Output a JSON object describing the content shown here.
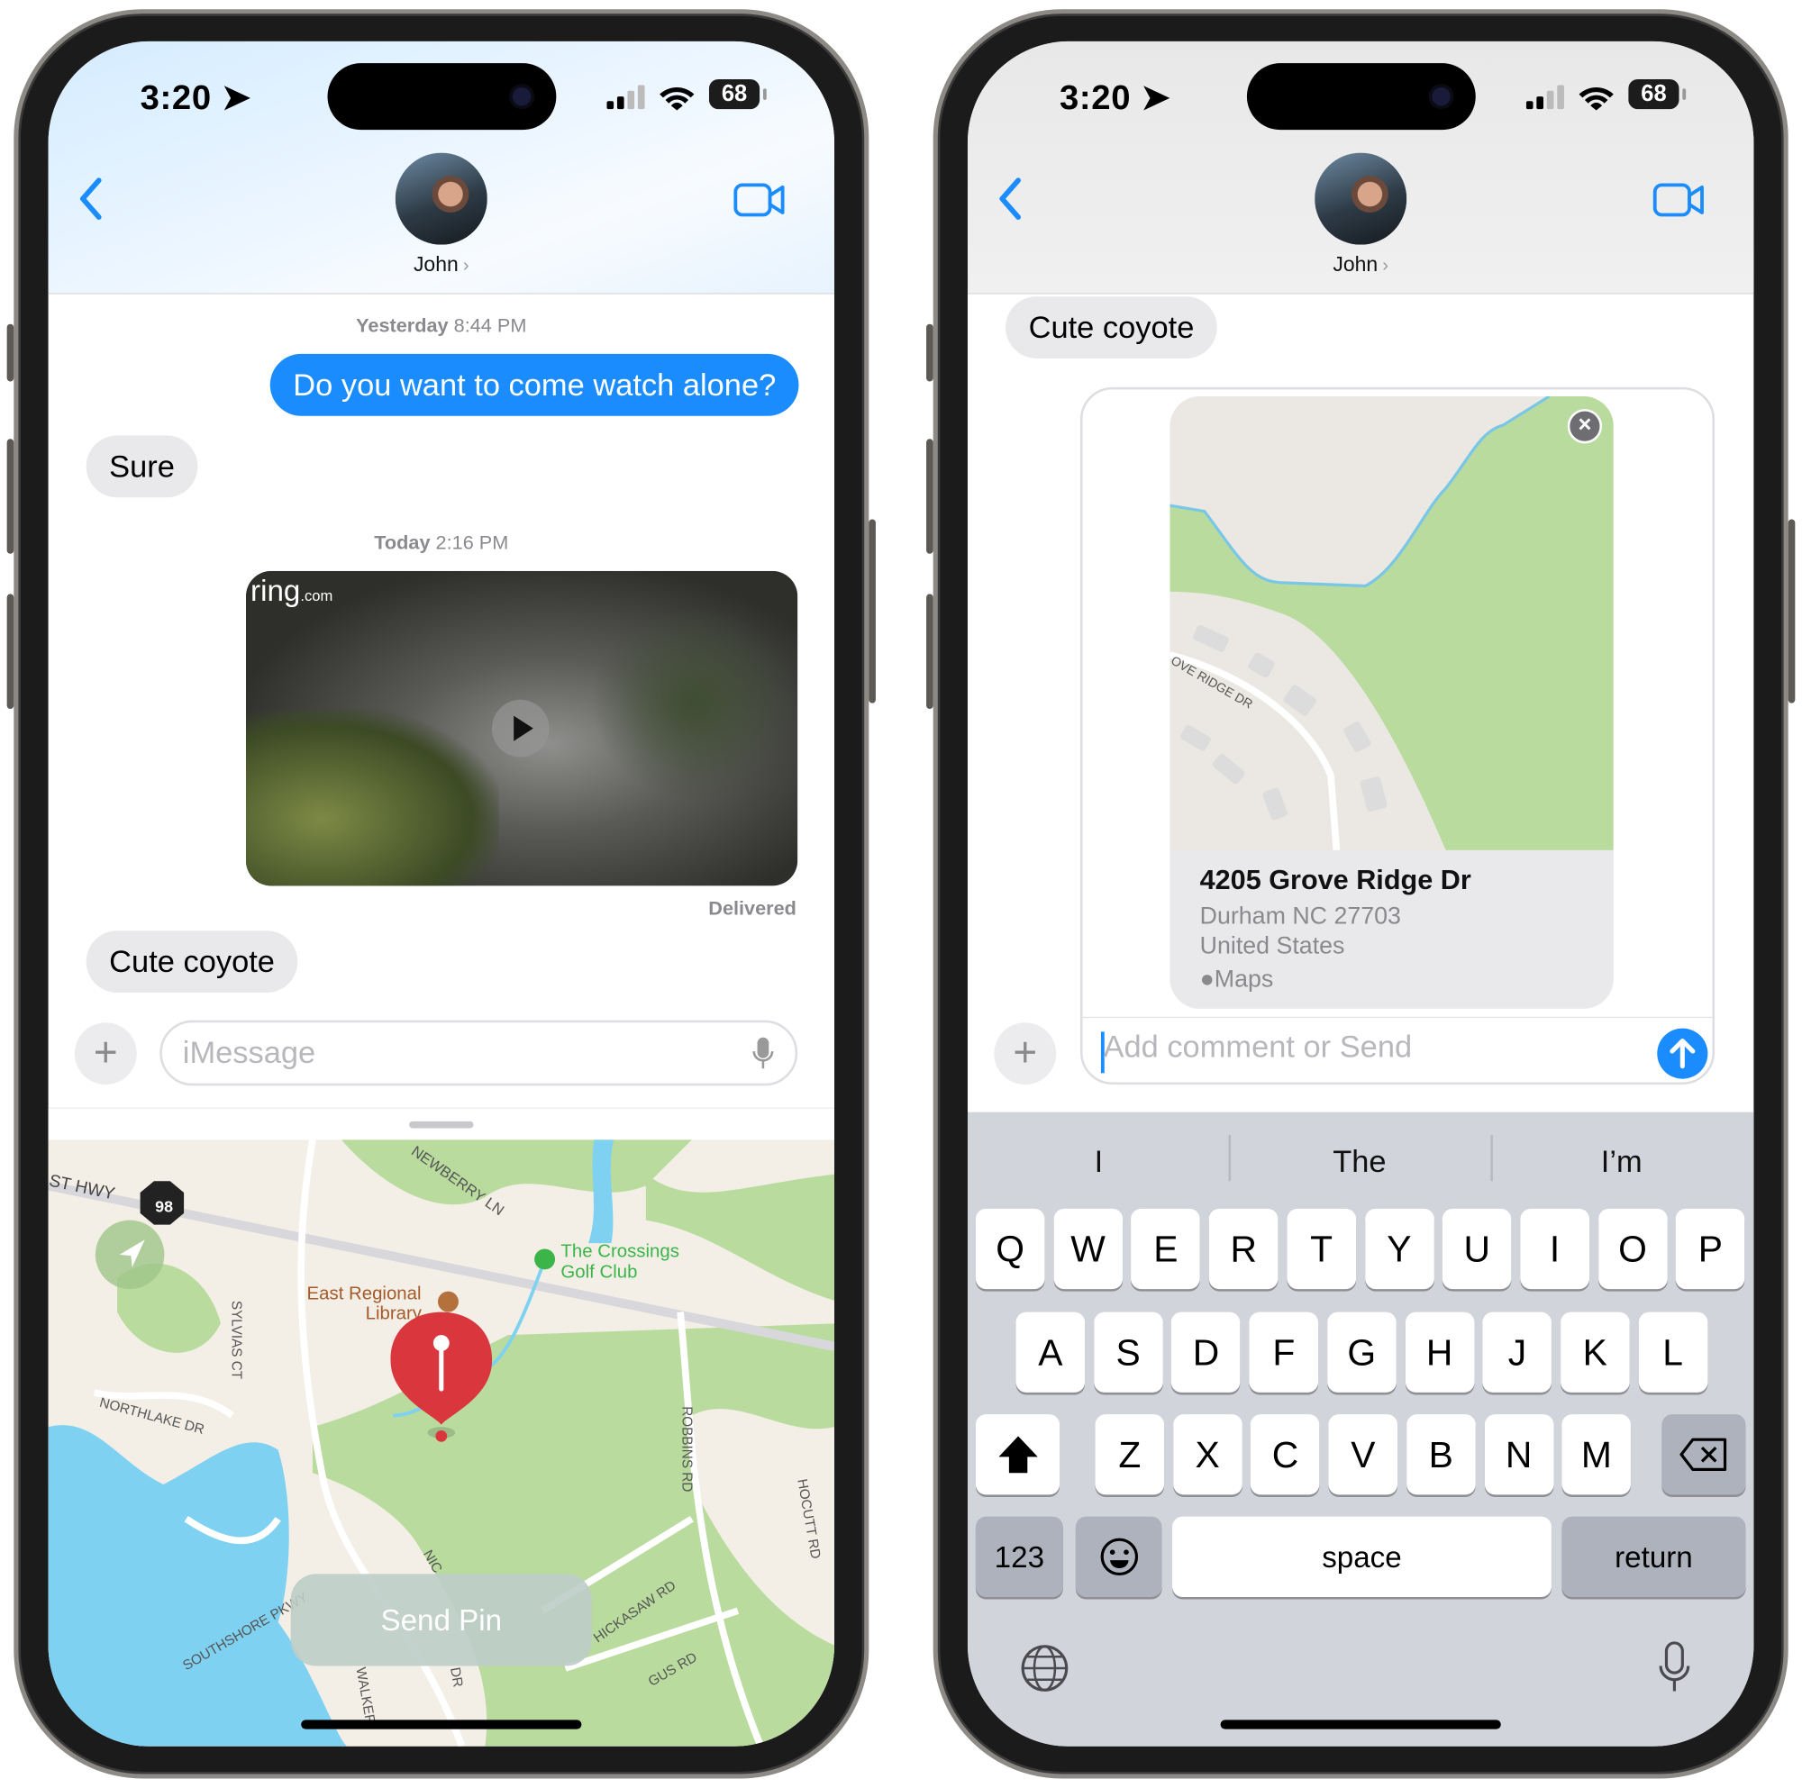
{
  "colors": {
    "accent": "#1a8cfd",
    "bubble_in": "#e9e9eb",
    "pin": "#d9363e",
    "map_green": "#b9dc9e",
    "map_water": "#7fd1f2",
    "keyboard_bg": "#d1d4db"
  },
  "left": {
    "status": {
      "time": "3:20",
      "battery": "68"
    },
    "header": {
      "contact": "John",
      "chevron": "›"
    },
    "messages": [
      {
        "type": "timestamp",
        "day": "Yesterday",
        "time": "8:44 PM"
      },
      {
        "type": "outgoing",
        "text": "Do you want to come watch alone?"
      },
      {
        "type": "incoming",
        "text": "Sure"
      },
      {
        "type": "timestamp",
        "day": "Today",
        "time": "2:16 PM"
      },
      {
        "type": "video",
        "watermark": "ring",
        "watermark_suffix": ".com"
      },
      {
        "type": "status",
        "text": "Delivered"
      },
      {
        "type": "incoming",
        "text": "Cute coyote"
      }
    ],
    "compose": {
      "placeholder": "iMessage"
    },
    "map": {
      "labels": {
        "hwy": "ST HWY",
        "route": "98",
        "newberry": "NEWBERRY LN",
        "crossings1": "The Crossings",
        "crossings2": "Golf Club",
        "library1": "East Regional",
        "library2": "Library",
        "sylvias": "SYLVIAS CT",
        "northlake": "NORTHLAKE DR",
        "robbins": "ROBBINS RD",
        "hocutt": "HOCUTT RD",
        "hickasaw": "HICKASAW RD",
        "gus": "GUS RD",
        "southshore": "SOUTHSHORE PKWY",
        "walker": "WALKER",
        "nic": "NIC",
        "dr": "DR"
      },
      "send_pin": "Send Pin"
    }
  },
  "right": {
    "status": {
      "time": "3:20",
      "battery": "68"
    },
    "header": {
      "contact": "John",
      "chevron": "›"
    },
    "messages": [
      {
        "type": "incoming",
        "text": "Cute coyote"
      }
    ],
    "location_card": {
      "street_label": "OVE RIDGE DR",
      "address": "4205 Grove Ridge Dr",
      "city": "Durham NC 27703",
      "country": "United States",
      "source": "Maps",
      "apple_glyph": ""
    },
    "compose": {
      "placeholder": "Add comment or Send"
    },
    "keyboard": {
      "suggestions": [
        "I",
        "The",
        "I’m"
      ],
      "row1": [
        "Q",
        "W",
        "E",
        "R",
        "T",
        "Y",
        "U",
        "I",
        "O",
        "P"
      ],
      "row2": [
        "A",
        "S",
        "D",
        "F",
        "G",
        "H",
        "J",
        "K",
        "L"
      ],
      "row3": [
        "Z",
        "X",
        "C",
        "V",
        "B",
        "N",
        "M"
      ],
      "numbers": "123",
      "space": "space",
      "return": "return"
    }
  }
}
